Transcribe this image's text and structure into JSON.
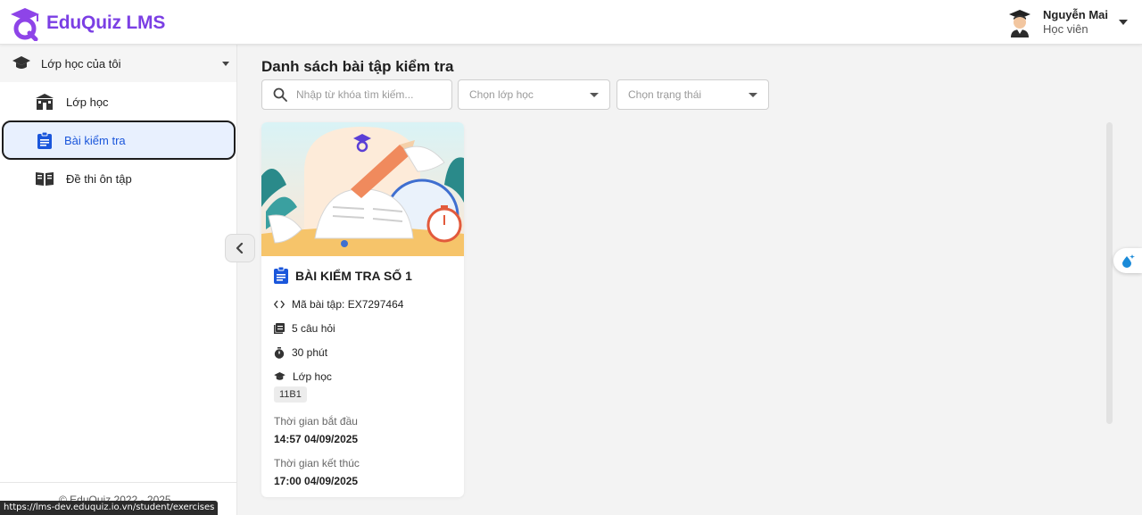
{
  "app": {
    "name": "EduQuiz LMS"
  },
  "user": {
    "name": "Nguyễn Mai",
    "role": "Học viên"
  },
  "sidebar": {
    "group_label": "Lớp học của tôi",
    "items": [
      {
        "label": "Lớp học",
        "icon": "school-icon"
      },
      {
        "label": "Bài kiểm tra",
        "icon": "clipboard-icon",
        "active": true
      },
      {
        "label": "Đề thi ôn tập",
        "icon": "book-icon"
      }
    ],
    "footer": "© EduQuiz 2022 - 2025"
  },
  "main": {
    "title": "Danh sách bài tập kiểm tra",
    "search": {
      "placeholder": "Nhập từ khóa tìm kiếm..."
    },
    "class_select": {
      "placeholder": "Chọn lớp học"
    },
    "status_select": {
      "placeholder": "Chọn trạng thái"
    }
  },
  "card": {
    "title": "BÀI KIỂM TRA SỐ 1",
    "code": "Mã bài tập: EX7297464",
    "questions": "5 câu hỏi",
    "duration": "30 phút",
    "class_label": "Lớp học",
    "class_chip": "11B1",
    "start_label": "Thời gian bắt đầu",
    "start_value": "14:57 04/09/2025",
    "end_label": "Thời gian kết thúc",
    "end_value": "17:00 04/09/2025"
  },
  "status_bar": {
    "url": "https://lms-dev.eduquiz.io.vn/student/exercises"
  },
  "colors": {
    "brand": "#7b3fe4",
    "accent": "#1a56db",
    "active_bg": "#e8f0fe"
  }
}
